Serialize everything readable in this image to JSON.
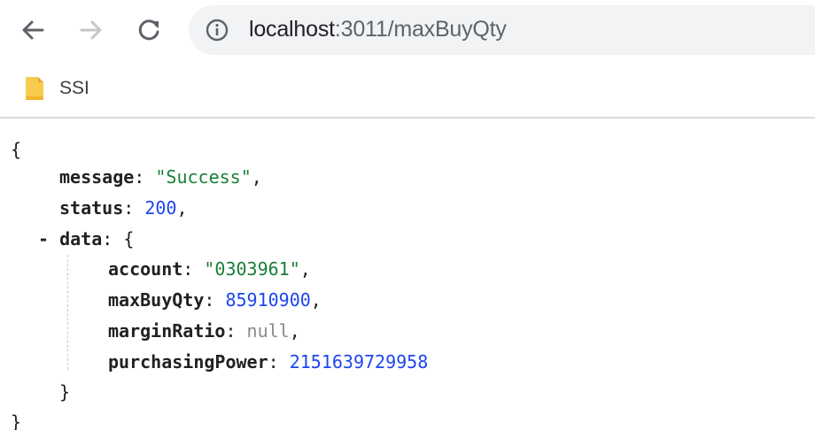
{
  "browser": {
    "url_host": "localhost",
    "url_rest": ":3011/maxBuyQty",
    "icons": {
      "back": "arrow-left-icon",
      "forward": "arrow-right-icon",
      "reload": "reload-icon",
      "info": "info-circle-icon",
      "bookmark": "folder-icon"
    },
    "colors": {
      "omnibox_bg": "#f1f3f4",
      "folder": "#f7cb4d"
    }
  },
  "bookmarks": {
    "items": [
      {
        "label": "SSI"
      }
    ]
  },
  "json_view": {
    "open_brace": "{",
    "close_brace": "}",
    "message_key": "message",
    "message_value": "\"Success\"",
    "status_key": "status",
    "status_value": "200",
    "data_toggle": "-",
    "data_key": "data",
    "data_open": "{",
    "data_close": "}",
    "account_key": "account",
    "account_value": "\"0303961\"",
    "maxbuyqty_key": "maxBuyQty",
    "maxbuyqty_value": "85910900",
    "marginratio_key": "marginRatio",
    "marginratio_value": "null",
    "purchasingpower_key": "purchasingPower",
    "purchasingpower_value": "2151639729958"
  }
}
